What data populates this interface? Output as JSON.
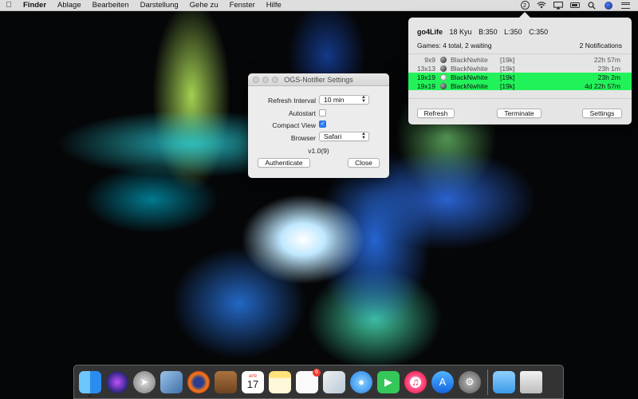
{
  "menubar": {
    "app": "Finder",
    "items": [
      "Ablage",
      "Bearbeiten",
      "Darstellung",
      "Gehe zu",
      "Fenster",
      "Hilfe"
    ],
    "status_count": "2"
  },
  "settings": {
    "title": "OGS-Notifier Settings",
    "refresh_label": "Refresh Interval",
    "refresh_value": "10 min",
    "autostart_label": "Autostart",
    "compact_label": "Compact View",
    "compact_check": "✓",
    "browser_label": "Browser",
    "browser_value": "Safari",
    "version": "v1.0(9)",
    "authenticate": "Authenticate",
    "close": "Close"
  },
  "popover": {
    "user": "go4Life",
    "rank": "18 Kyu",
    "b": "B:350",
    "l": "L:350",
    "c": "C:350",
    "games_summary": "Games: 4 total, 2 waiting",
    "notifications": "2 Notifications",
    "games": [
      {
        "size": "9x9",
        "stone": "black",
        "name": "BlackNwhite",
        "rank": "[19k]",
        "time": "22h 57m",
        "highlight": false
      },
      {
        "size": "13x13",
        "stone": "black",
        "name": "BlackNwhite",
        "rank": "[19k]",
        "time": "23h 1m",
        "highlight": false
      },
      {
        "size": "19x19",
        "stone": "white",
        "name": "BlackNwhite",
        "rank": "[19k]",
        "time": "23h 2m",
        "highlight": true
      },
      {
        "size": "19x19",
        "stone": "black",
        "name": "BlackNwhite",
        "rank": "[19k]",
        "time": "4d 22h 57m",
        "highlight": true
      }
    ],
    "refresh": "Refresh",
    "terminate": "Terminate",
    "settings": "Settings"
  },
  "dock": {
    "calendar_month": "APR",
    "calendar_day": "17",
    "reminders_badge": "6"
  },
  "colors": {
    "highlight": "#22f25a",
    "checkbox": "#2f7cf6"
  }
}
